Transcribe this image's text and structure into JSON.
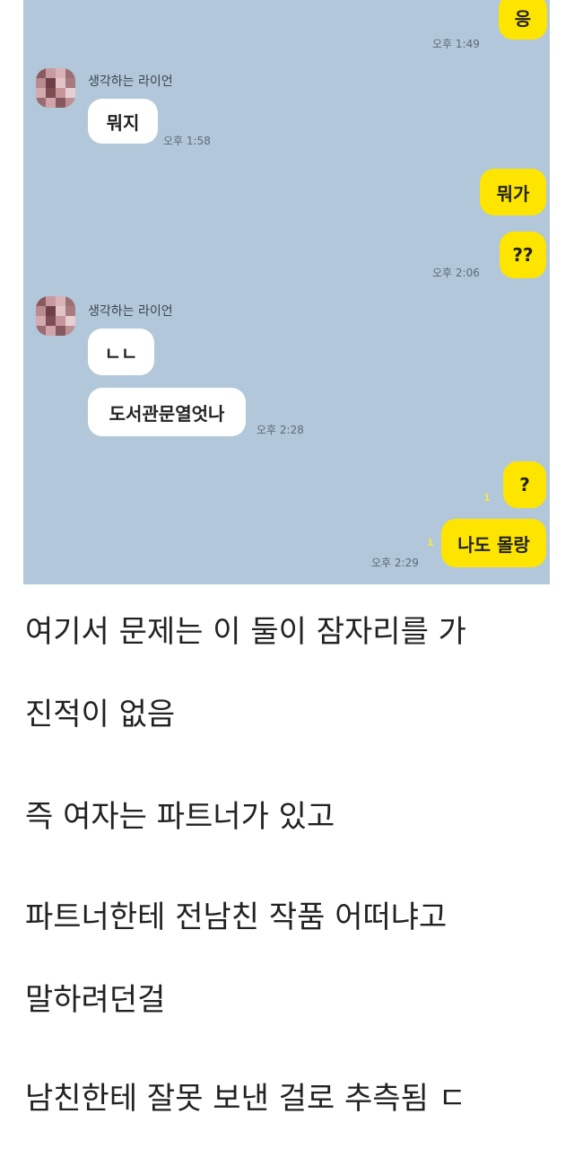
{
  "chat": {
    "msg1": {
      "text": "응",
      "time": "오후 1:49"
    },
    "sender_name": "생각하는 라이언",
    "msg2": {
      "text": "뭐지",
      "time": "오후 1:58"
    },
    "msg3": {
      "text": "뭐가"
    },
    "msg4": {
      "text": "??",
      "time": "오후 2:06"
    },
    "msg5": {
      "text": "ㄴㄴ"
    },
    "msg6": {
      "text": "도서관문열엇나",
      "time": "오후 2:28"
    },
    "msg7": {
      "text": "?",
      "unread": "1"
    },
    "msg8": {
      "text": "나도 몰랑",
      "time": "오후 2:29",
      "unread": "1"
    }
  },
  "captions": [
    "여기서 문제는 이 둘이 잠자리를 가",
    "진적이 없음",
    "즉 여자는 파트너가 있고",
    "파트너한테 전남친 작품 어떠냐고",
    "말하려던걸",
    "남친한테 잘못 보낸 걸로 추측됨 ㄷ"
  ],
  "colors": {
    "chat_bg": "#b2c7d9",
    "my_bubble": "#fee500",
    "other_bubble": "#ffffff"
  }
}
